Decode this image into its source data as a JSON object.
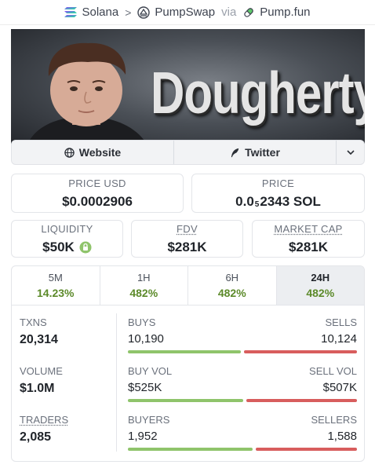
{
  "breadcrumb": {
    "chain": "Solana",
    "dex": "PumpSwap",
    "via": "via",
    "launchpad": "Pump.fun"
  },
  "banner": {
    "title": "Dougherty"
  },
  "links": {
    "website": "Website",
    "twitter": "Twitter"
  },
  "price": {
    "usd_label": "PRICE USD",
    "usd_value": "$0.0002906",
    "sol_label": "PRICE",
    "sol_prefix": "0.0",
    "sol_zeros": "5",
    "sol_digits": "2343 SOL"
  },
  "metrics": {
    "liquidity_label": "LIQUIDITY",
    "liquidity_value": "$50K",
    "fdv_label": "FDV",
    "fdv_value": "$281K",
    "mcap_label": "MARKET CAP",
    "mcap_value": "$281K"
  },
  "timeframes": [
    {
      "label": "5M",
      "change": "14.23%"
    },
    {
      "label": "1H",
      "change": "482%"
    },
    {
      "label": "6H",
      "change": "482%"
    },
    {
      "label": "24H",
      "change": "482%"
    }
  ],
  "stats": {
    "txns_label": "TXNS",
    "txns_value": "20,314",
    "buys_label": "BUYS",
    "buys_value": "10,190",
    "sells_label": "SELLS",
    "sells_value": "10,124",
    "buys_ratio": 0.5016,
    "volume_label": "VOLUME",
    "volume_value": "$1.0M",
    "buyvol_label": "BUY VOL",
    "buyvol_value": "$525K",
    "sellvol_label": "SELL VOL",
    "sellvol_value": "$507K",
    "buyvol_ratio": 0.5087,
    "traders_label": "TRADERS",
    "traders_value": "2,085",
    "buyers_label": "BUYERS",
    "buyers_value": "1,952",
    "sellers_label": "SELLERS",
    "sellers_value": "1,588",
    "buyers_ratio": 0.5515
  },
  "colors": {
    "positive": "#5c8a2a",
    "buy_bar": "#8fc46b",
    "sell_bar": "#d85d5d",
    "active_tab": "#eceef1"
  },
  "icons": {
    "solana": "solana-icon",
    "pumpswap": "pumpswap-icon",
    "pumpfun": "pill-icon",
    "website": "globe-icon",
    "twitter": "feather-icon",
    "more": "chevron-down-icon",
    "liquidity_lock": "lock-icon"
  }
}
